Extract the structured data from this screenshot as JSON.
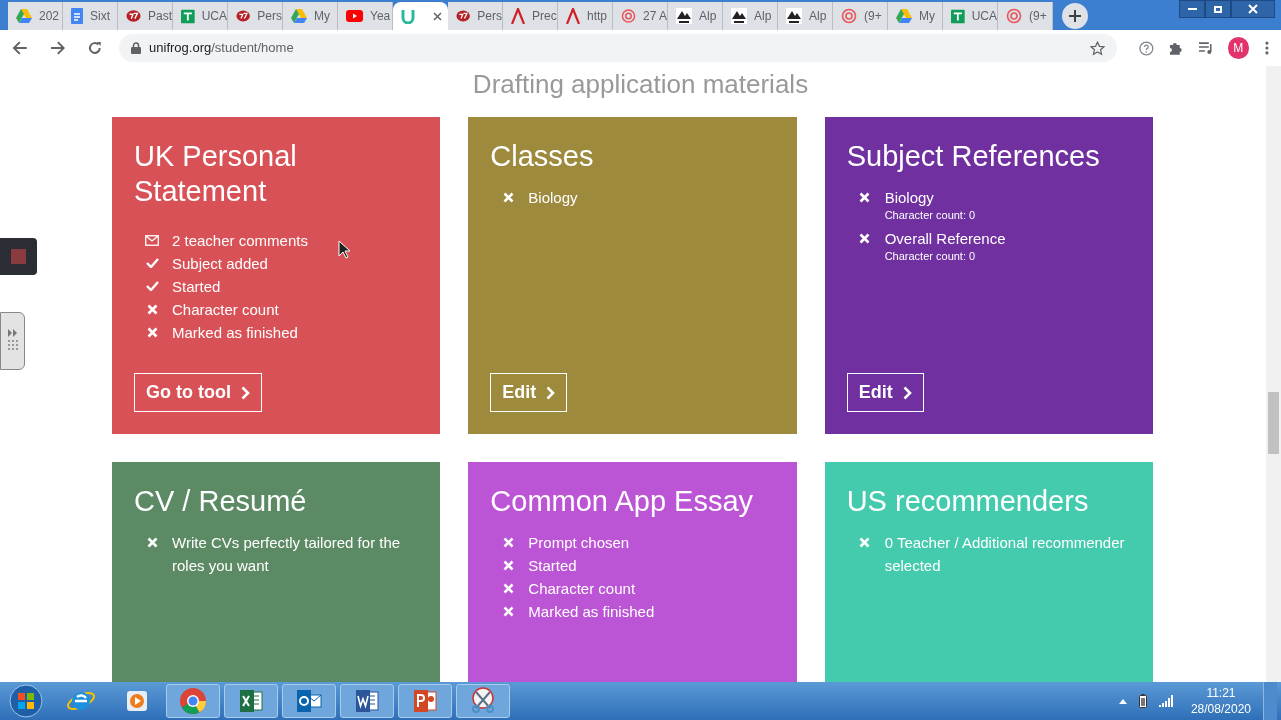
{
  "browser": {
    "tabs": [
      {
        "title": "202",
        "selected": false
      },
      {
        "title": "Sixt",
        "selected": false
      },
      {
        "title": "Past",
        "selected": false
      },
      {
        "title": "UCA",
        "selected": false
      },
      {
        "title": "Pers",
        "selected": false
      },
      {
        "title": "My",
        "selected": false
      },
      {
        "title": "Yea",
        "selected": false
      },
      {
        "selected": true
      },
      {
        "title": "Pers",
        "selected": false
      },
      {
        "title": "Prec",
        "selected": false
      },
      {
        "title": "http",
        "selected": false
      },
      {
        "title": "27 A",
        "selected": false
      },
      {
        "title": "Alp",
        "selected": false
      },
      {
        "title": "Alp",
        "selected": false
      },
      {
        "title": "Alp",
        "selected": false
      },
      {
        "title": "(9+",
        "selected": false
      },
      {
        "title": "My",
        "selected": false
      },
      {
        "title": "UCA",
        "selected": false
      },
      {
        "title": "(9+",
        "selected": false
      }
    ],
    "url_host": "unifrog.org",
    "url_path": "/student/home",
    "profile": "M"
  },
  "page": {
    "heading": "Drafting application materials",
    "cards": [
      {
        "title": "UK Personal Statement",
        "color": "#d85157",
        "items": [
          {
            "kind": "mail",
            "text": "2 teacher comments"
          },
          {
            "kind": "done",
            "text": "Subject added"
          },
          {
            "kind": "done",
            "text": "Started"
          },
          {
            "kind": "todo",
            "text": "Character count"
          },
          {
            "kind": "todo",
            "text": "Marked as finished"
          }
        ],
        "button": "Go to tool"
      },
      {
        "title": "Classes",
        "color": "#9d8a3d",
        "items": [
          {
            "kind": "todo",
            "text": "Biology"
          }
        ],
        "button": "Edit"
      },
      {
        "title": "Subject References",
        "color": "#7030a0",
        "items": [
          {
            "kind": "todo",
            "text": "Biology",
            "note": "Character count: 0"
          },
          {
            "kind": "todo",
            "text": "Overall Reference",
            "note": "Character count: 0"
          }
        ],
        "button": "Edit"
      },
      {
        "title": "CV / Resumé",
        "color": "#5b8a64",
        "items": [
          {
            "kind": "todo",
            "text": "Write CVs perfectly tailored for the roles you want"
          }
        ]
      },
      {
        "title": "Common App Essay",
        "color": "#bc55d5",
        "items": [
          {
            "kind": "todo",
            "text": "Prompt chosen"
          },
          {
            "kind": "todo",
            "text": "Started"
          },
          {
            "kind": "todo",
            "text": "Character count"
          },
          {
            "kind": "todo",
            "text": "Marked as finished"
          }
        ]
      },
      {
        "title": "US recommenders",
        "color": "#44cbad",
        "items": [
          {
            "kind": "todo",
            "text": "0 Teacher / Additional recommender selected"
          }
        ]
      }
    ]
  },
  "taskbar": {
    "time": "11:21",
    "date": "28/08/2020"
  }
}
